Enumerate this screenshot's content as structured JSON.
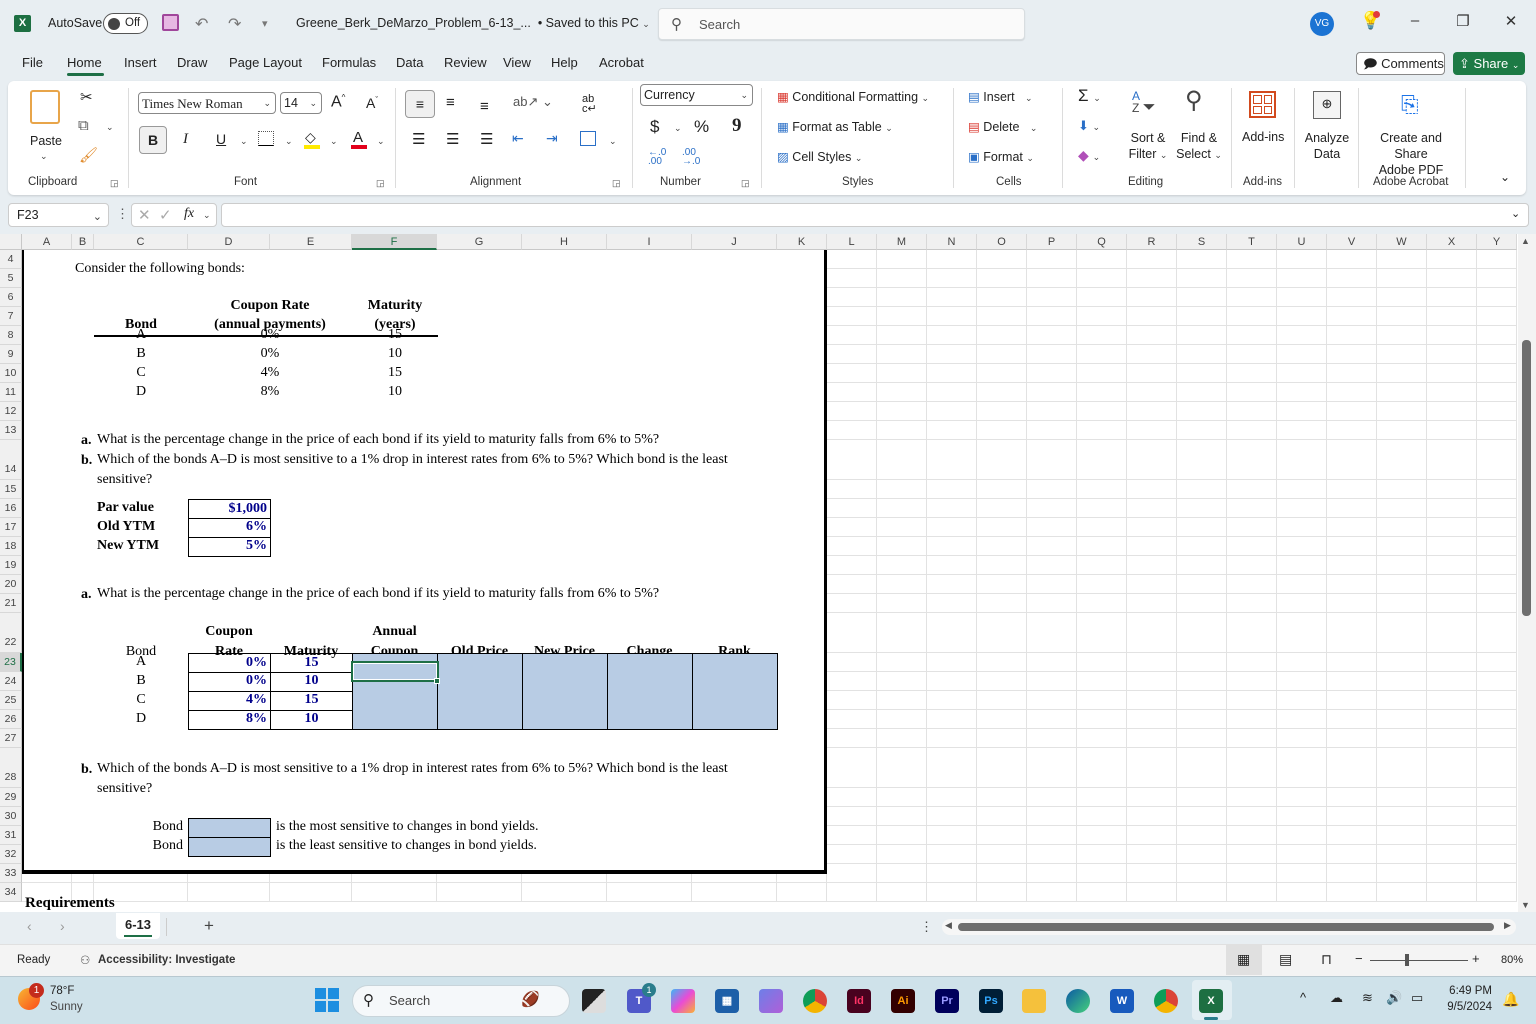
{
  "titlebar": {
    "app_logo": "X",
    "autosave_label": "AutoSave",
    "autosave_state": "Off",
    "document_title": "Greene_Berk_DeMarzo_Problem_6-13_...",
    "save_status": "• Saved to this PC",
    "search_placeholder": "Search",
    "user_initials": "VG"
  },
  "menu": {
    "items": [
      "File",
      "Home",
      "Insert",
      "Draw",
      "Page Layout",
      "Formulas",
      "Data",
      "Review",
      "View",
      "Help",
      "Acrobat"
    ],
    "active": "Home",
    "comments_label": "Comments",
    "share_label": "Share"
  },
  "ribbon": {
    "clipboard": {
      "paste_label": "Paste",
      "group_label": "Clipboard"
    },
    "font": {
      "font_name": "Times New Roman",
      "font_size": "14",
      "bold": "B",
      "italic": "I",
      "underline": "U",
      "group_label": "Font"
    },
    "alignment": {
      "group_label": "Alignment"
    },
    "number": {
      "format": "Currency",
      "dollar": "$",
      "percent": "%",
      "comma": "9",
      "group_label": "Number"
    },
    "styles": {
      "conditional_formatting": "Conditional Formatting",
      "format_as_table": "Format as Table",
      "cell_styles": "Cell Styles",
      "group_label": "Styles"
    },
    "cells": {
      "insert": "Insert",
      "delete": "Delete",
      "format": "Format",
      "group_label": "Cells"
    },
    "editing": {
      "sort_filter_1": "Sort &",
      "sort_filter_2": "Filter",
      "find_select_1": "Find &",
      "find_select_2": "Select",
      "group_label": "Editing"
    },
    "addins": {
      "label": "Add-ins",
      "group_label": "Add-ins"
    },
    "analyze": {
      "label_1": "Analyze",
      "label_2": "Data"
    },
    "acrobat": {
      "label_1": "Create and Share",
      "label_2": "Adobe PDF",
      "group_label": "Adobe Acrobat"
    }
  },
  "formula_bar": {
    "name_box": "F23",
    "fx": "fx",
    "formula": ""
  },
  "columns": [
    "A",
    "B",
    "C",
    "D",
    "E",
    "F",
    "G",
    "H",
    "I",
    "J",
    "K",
    "L",
    "M",
    "N",
    "O",
    "P",
    "Q",
    "R",
    "S",
    "T",
    "U",
    "V",
    "W",
    "X",
    "Y"
  ],
  "selected_column": "F",
  "rows": [
    "4",
    "5",
    "6",
    "7",
    "8",
    "9",
    "10",
    "11",
    "12",
    "13",
    "14",
    "15",
    "16",
    "17",
    "18",
    "19",
    "20",
    "21",
    "22",
    "23",
    "24",
    "25",
    "26",
    "27",
    "28",
    "29",
    "30",
    "31",
    "32",
    "33",
    "34"
  ],
  "selected_row": "23",
  "sheet": {
    "intro": "Consider the following bonds:",
    "bond_table": {
      "headers": {
        "bond": "Bond",
        "coupon_1": "Coupon Rate",
        "coupon_2": "(annual payments)",
        "maturity_1": "Maturity",
        "maturity_2": "(years)"
      },
      "rows": [
        {
          "bond": "A",
          "coupon": "0%",
          "maturity": "15"
        },
        {
          "bond": "B",
          "coupon": "0%",
          "maturity": "10"
        },
        {
          "bond": "C",
          "coupon": "4%",
          "maturity": "15"
        },
        {
          "bond": "D",
          "coupon": "8%",
          "maturity": "10"
        }
      ]
    },
    "question_a_label": "a.",
    "question_a": "What is the percentage change in the price of each bond if its yield to maturity falls from 6% to 5%?",
    "question_b_label": "b.",
    "question_b_line1": "Which of the bonds A–D is most sensitive to a 1% drop in interest rates from 6% to 5%? Which bond is the least",
    "question_b_line2": "sensitive?",
    "inputs": [
      {
        "label": "Par value",
        "value": "$1,000"
      },
      {
        "label": "Old YTM",
        "value": "6%"
      },
      {
        "label": "New YTM",
        "value": "5%"
      }
    ],
    "answer_table": {
      "headers": {
        "bond": "Bond",
        "coupon_1": "Coupon",
        "coupon_2": "Rate",
        "maturity": "Maturity",
        "annual_1": "Annual",
        "annual_2": "Coupon",
        "old_price": "Old Price",
        "new_price": "New Price",
        "change": "Change",
        "rank": "Rank"
      },
      "rows": [
        {
          "bond": "A",
          "coupon": "0%",
          "maturity": "15"
        },
        {
          "bond": "B",
          "coupon": "0%",
          "maturity": "10"
        },
        {
          "bond": "C",
          "coupon": "4%",
          "maturity": "15"
        },
        {
          "bond": "D",
          "coupon": "8%",
          "maturity": "10"
        }
      ]
    },
    "answer_b": {
      "bond_label": "Bond",
      "most_text": "is the most sensitive to changes in bond yields.",
      "least_text": "is the least sensitive to changes in bond yields."
    },
    "requirements": "Requirements"
  },
  "sheet_tabs": {
    "active": "6-13",
    "add": "+"
  },
  "statusbar": {
    "ready": "Ready",
    "accessibility": "Accessibility: Investigate",
    "zoom": "80%",
    "zoom_fraction": 0.8
  },
  "taskbar": {
    "weather_temp": "78°F",
    "weather_desc": "Sunny",
    "weather_badge": "1",
    "search_placeholder": "Search",
    "teams_badge": "1",
    "time": "6:49 PM",
    "date": "9/5/2024"
  },
  "colors": {
    "accent_green": "#1e6f46",
    "input_fill": "#b8cce4",
    "input_text": "#00008b"
  }
}
